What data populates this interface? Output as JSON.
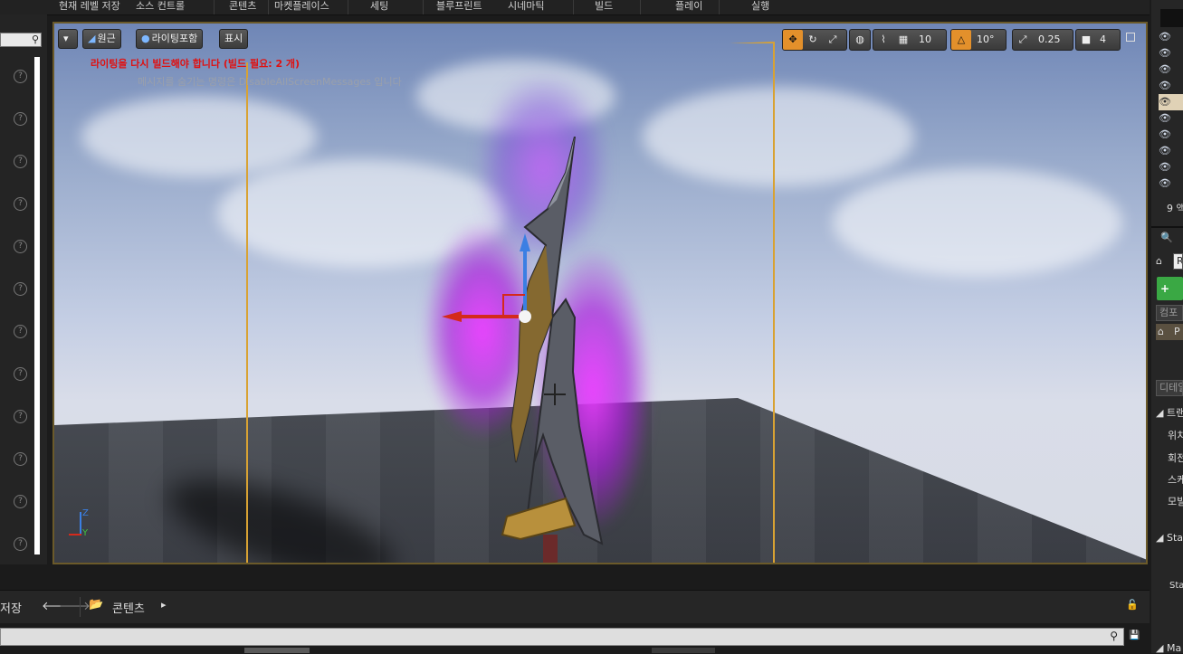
{
  "top_menu": [
    "현재 레벨 저장",
    "소스 컨트롤",
    "콘텐츠",
    "마켓플레이스",
    "세팅",
    "블루프린트",
    "시네마틱",
    "빌드",
    "플레이",
    "실행"
  ],
  "viewport": {
    "perspective_label": "원근",
    "lighting_label": "라이팅포함",
    "show_label": "표시",
    "warning_text": "라이팅을 다시 빌드해야 합니다 (빌드 필요: 2 개)",
    "hint_text": "메시지를 숨기는 명령은 DisableAllScreenMessages 입니다",
    "grid_snap_value": "10",
    "rotation_snap_value": "10°",
    "scale_snap_value": "0.25",
    "camera_speed_value": "4",
    "axis_z": "Z",
    "axis_y": "Y"
  },
  "right_panel": {
    "count_text": "9 액",
    "add_component_label": "+ 컴",
    "component_search_placeholder": "컴포",
    "actor_label": "P",
    "details_search_placeholder": "디테일",
    "transform_label": "트랜",
    "location_label": "위치",
    "rotation_label": "회전",
    "scale_label": "스케",
    "mobility_label": "모빌",
    "static_label": "Sta",
    "static_sub_label": "Sta",
    "materials_label": "Ma",
    "top_field": "R"
  },
  "bottom_bar": {
    "save_label": "저장",
    "folder_label": "콘텐츠"
  }
}
